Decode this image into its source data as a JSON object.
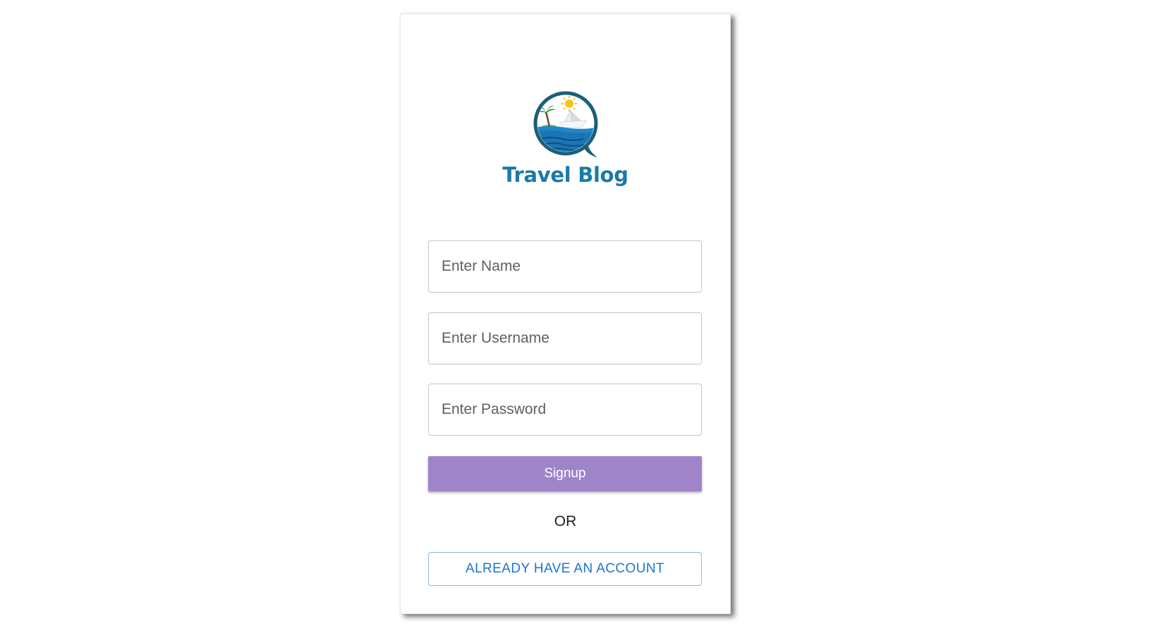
{
  "brand": {
    "name": "Travel Blog",
    "logo_icon": "travel-blog-logo-icon",
    "colors": {
      "brand_text": "#1b7aa6",
      "ring": "#1a5f7a",
      "sea": "#1e88c7",
      "sun": "#f5c518",
      "palm": "#2e8b3a"
    }
  },
  "form": {
    "name_placeholder": "Enter Name",
    "username_placeholder": "Enter Username",
    "password_placeholder": "Enter Password",
    "signup_label": "Signup",
    "divider_text": "OR",
    "account_label": "ALREADY HAVE AN ACCOUNT"
  },
  "colors": {
    "signup_button": "#a084ca",
    "account_button_text": "#1976d2",
    "field_border": "#c4c4c4"
  }
}
